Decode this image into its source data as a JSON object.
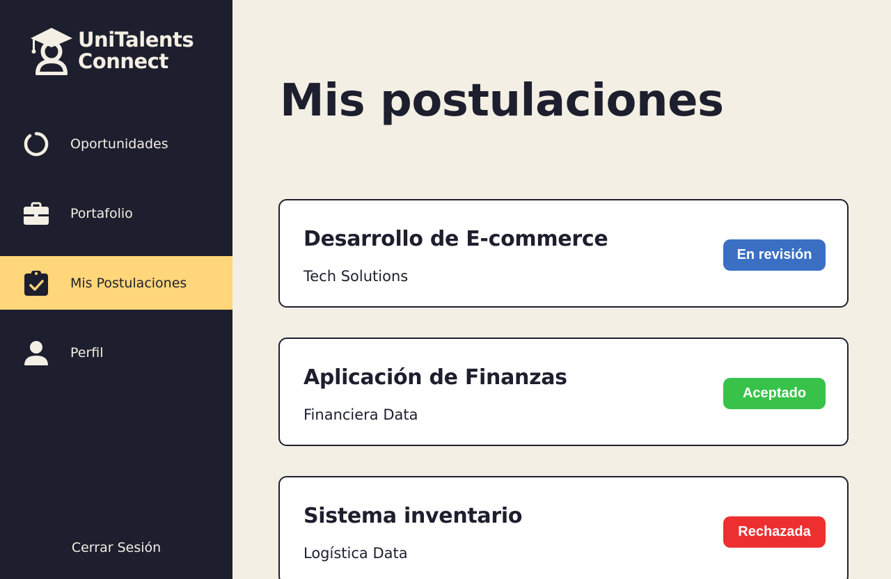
{
  "app": {
    "name_line1": "UniTalents",
    "name_line2": "Connect"
  },
  "sidebar": {
    "items": [
      {
        "label": "Oportunidades",
        "icon": "ring-icon",
        "active": false
      },
      {
        "label": "Portafolio",
        "icon": "briefcase-icon",
        "active": false
      },
      {
        "label": "Mis Postulaciones",
        "icon": "clipboard-check-icon",
        "active": true
      },
      {
        "label": "Perfil",
        "icon": "user-icon",
        "active": false
      }
    ],
    "logout_label": "Cerrar Sesión"
  },
  "main": {
    "title": "Mis postulaciones",
    "applications": [
      {
        "title": "Desarrollo de E-commerce",
        "company": "Tech Solutions",
        "status": "En revisión",
        "status_color": "#3a6fc4"
      },
      {
        "title": "Aplicación de Finanzas",
        "company": "Financiera Data",
        "status": "Aceptado",
        "status_color": "#38c24a"
      },
      {
        "title": "Sistema inventario",
        "company": "Logística Data",
        "status": "Rechazada",
        "status_color": "#ee2f2f"
      }
    ]
  },
  "colors": {
    "sidebar_bg": "#1d1f2e",
    "page_bg": "#f4efe4",
    "active_item": "#ffd679",
    "text_dark": "#1d1f2e"
  }
}
